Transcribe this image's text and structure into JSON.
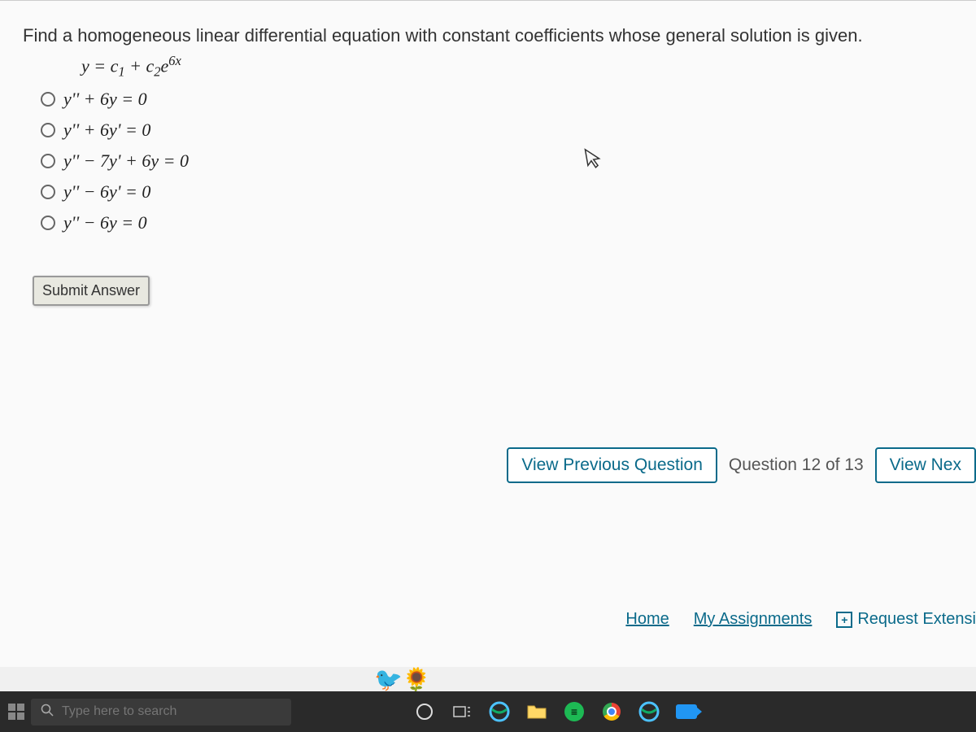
{
  "question": {
    "prompt": "Find a homogeneous linear differential equation with constant coefficients whose general solution is given.",
    "formula_plain": "y = c1 + c2 e^(6x)",
    "options": [
      "y'' + 6y = 0",
      "y'' + 6y' = 0",
      "y'' − 7y' + 6y = 0",
      "y'' − 6y' = 0",
      "y'' − 6y = 0"
    ],
    "submit_label": "Submit Answer"
  },
  "nav": {
    "prev_label": "View Previous Question",
    "count_label": "Question 12 of 13",
    "next_label": "View Nex"
  },
  "footer_links": {
    "home": "Home",
    "assignments": "My Assignments",
    "extension": "Request Extensi"
  },
  "taskbar": {
    "search_placeholder": "Type here to search"
  }
}
